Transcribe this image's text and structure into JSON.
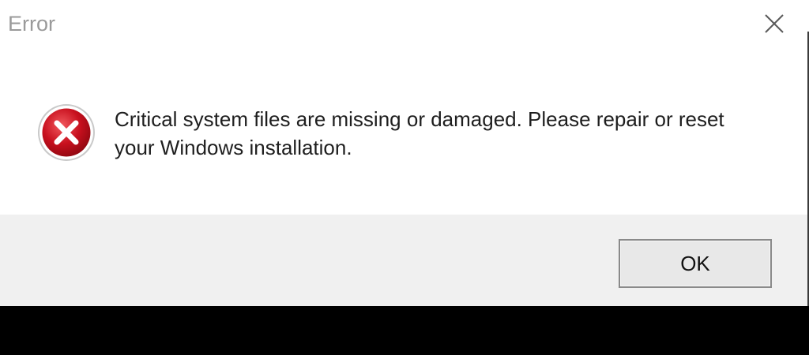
{
  "window": {
    "title": "Error",
    "close_icon": "close-icon"
  },
  "message": {
    "icon": "error-icon",
    "text": "Critical system files are missing or damaged. Please repair or reset your Windows installation."
  },
  "footer": {
    "ok_label": "OK"
  },
  "colors": {
    "title_text": "#9a9a9a",
    "message_text": "#1e1e1e",
    "footer_background": "#f0f0f0",
    "error_red": "#c8101e",
    "backdrop": "#000000"
  }
}
